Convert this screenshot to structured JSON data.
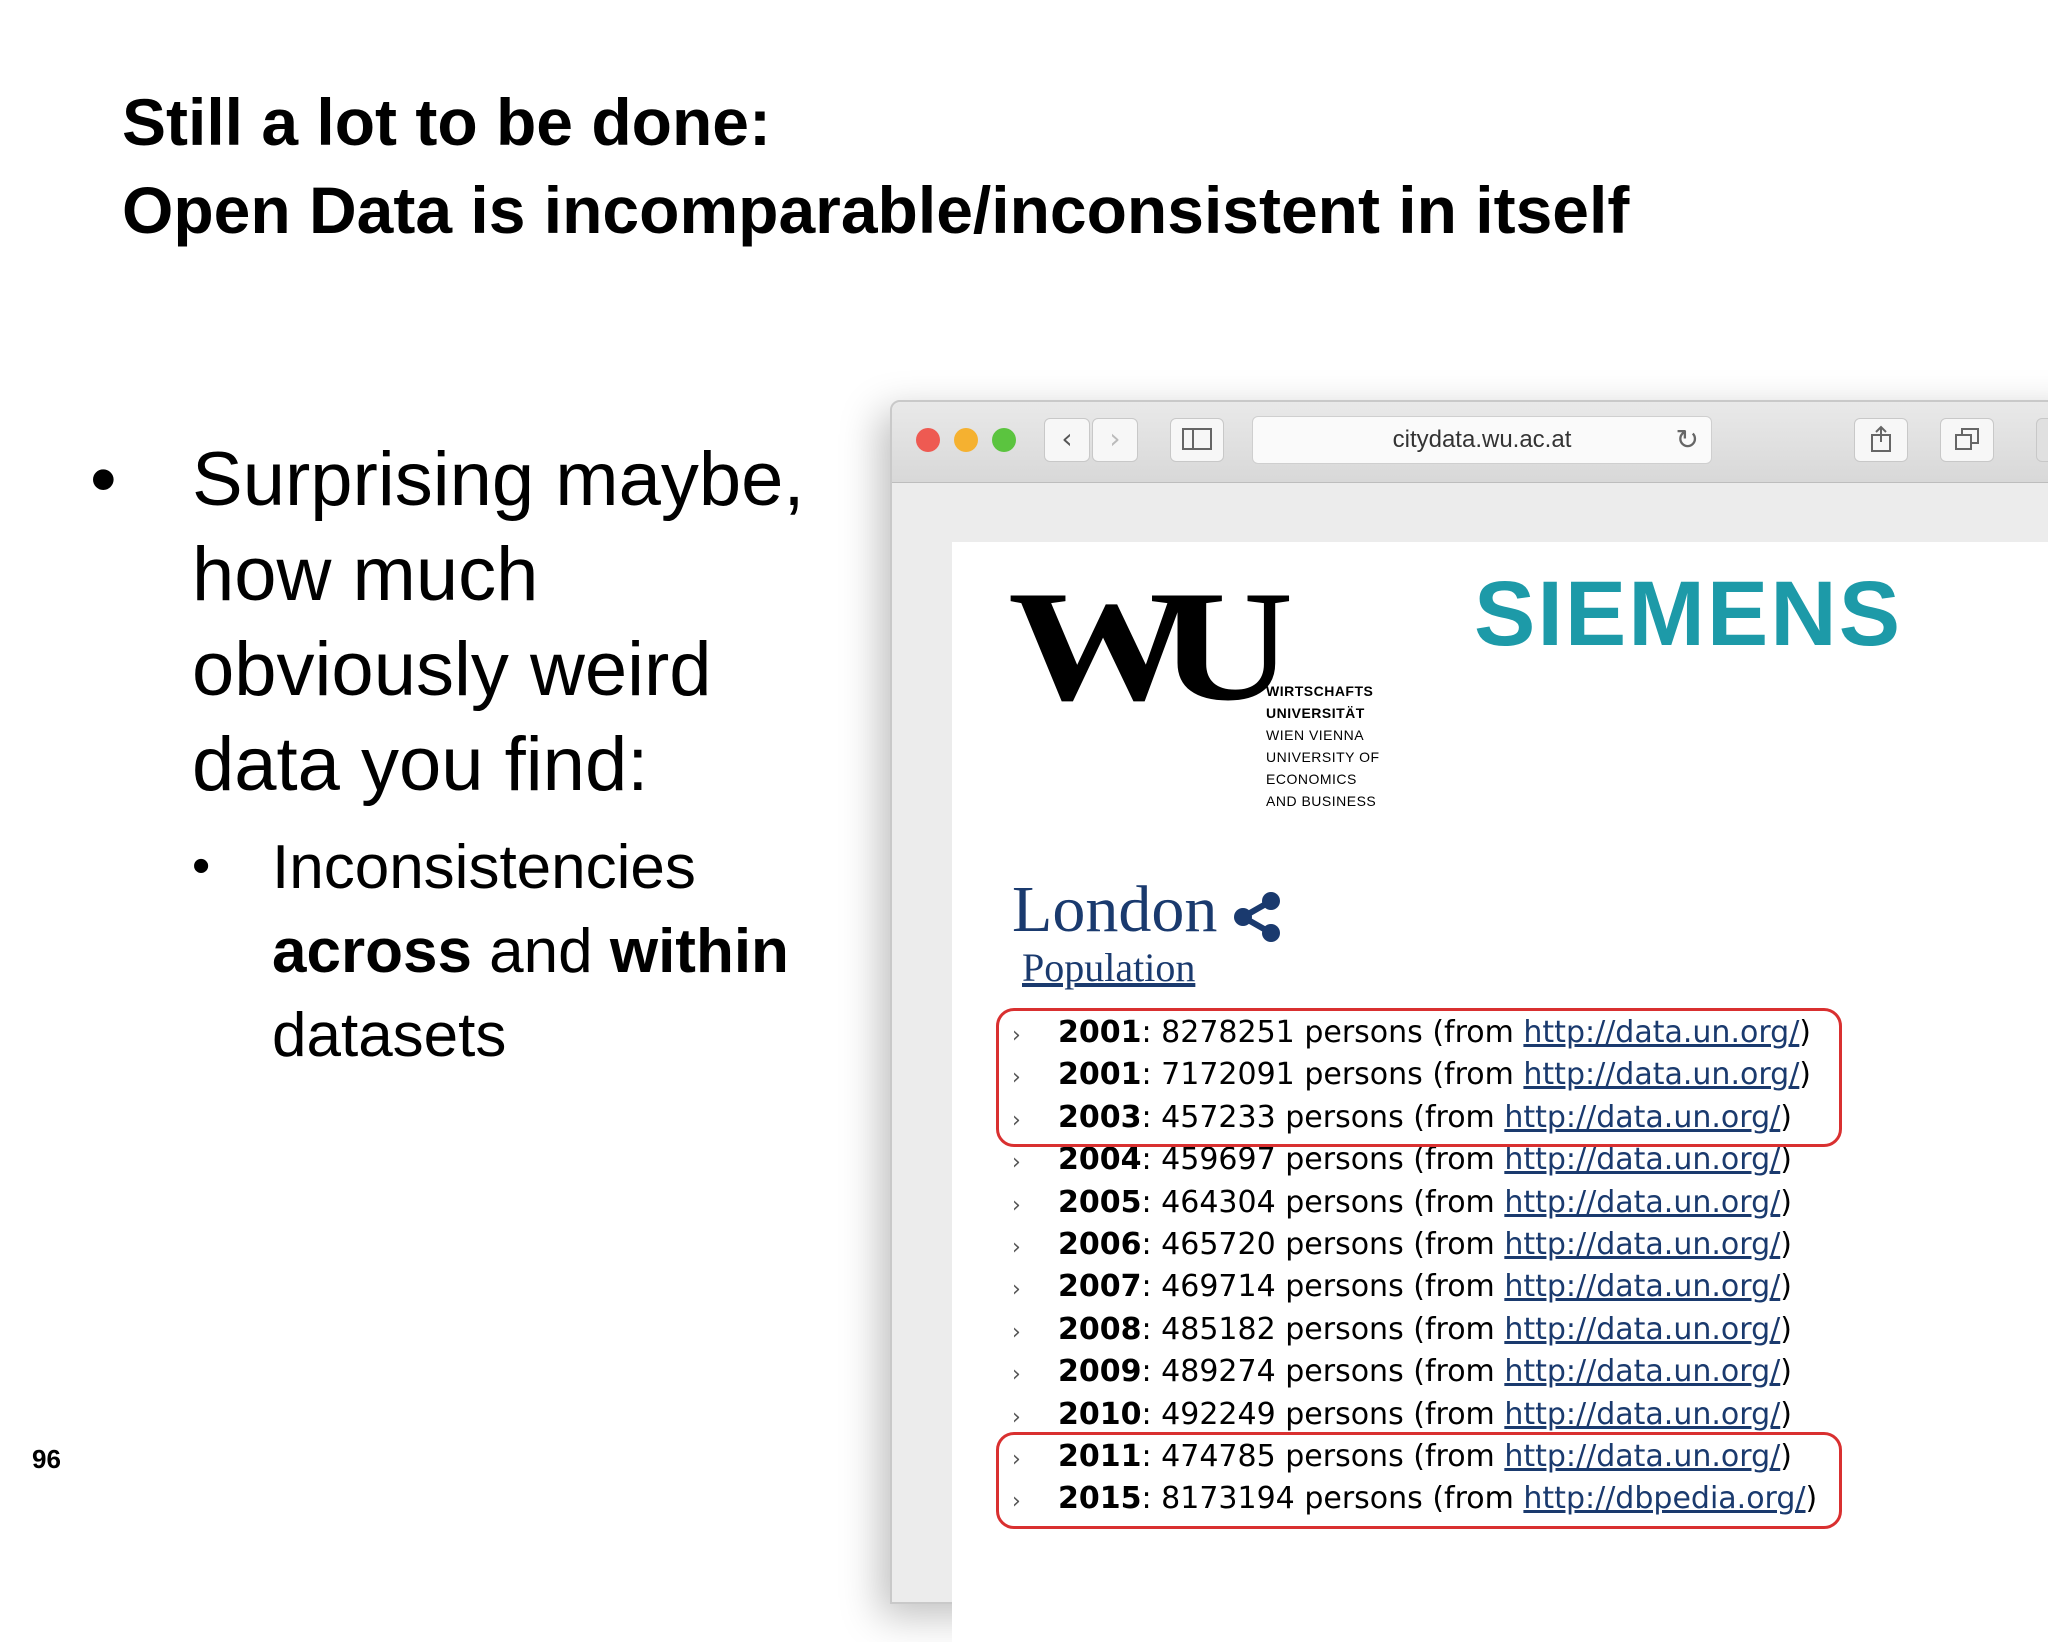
{
  "slide": {
    "title_line1": "Still a lot to be done:",
    "title_line2": "Open Data is incomparable/inconsistent in itself",
    "bullet1": "Surprising maybe, how much obviously weird data you find:",
    "sub_bullet": {
      "text1": "Inconsistencies",
      "bold1": "across",
      "text2": "and",
      "bold2": "within",
      "text3": "datasets"
    },
    "page_number": "96",
    "bullet_glyph": "•"
  },
  "browser": {
    "url": "citydata.wu.ac.at",
    "traffic_lights": {
      "close": "#ee5a52",
      "minimize": "#f5b130",
      "zoom": "#5bc43f"
    },
    "icons": {
      "back": "chevron-left-icon",
      "forward": "chevron-right-icon",
      "sidebar": "sidebar-icon",
      "reload": "reload-icon",
      "share": "share-icon",
      "tabs": "tabs-icon"
    }
  },
  "page": {
    "wu_logo_letters": "WU",
    "wu_logo_text": [
      "WIRTSCHAFTS",
      "UNIVERSITÄT",
      "WIEN VIENNA",
      "UNIVERSITY OF",
      "ECONOMICS",
      "AND BUSINESS"
    ],
    "siemens_logo": "SIEMENS",
    "siemens_color": "#1d9aa8",
    "city": "London",
    "section_link": "Population",
    "unit": "persons",
    "from_prefix": "(from",
    "from_suffix": ")",
    "rows": [
      {
        "year": "2001",
        "value": "8278251",
        "source": "http://data.un.org/"
      },
      {
        "year": "2001",
        "value": "7172091",
        "source": "http://data.un.org/"
      },
      {
        "year": "2003",
        "value": "457233",
        "source": "http://data.un.org/"
      },
      {
        "year": "2004",
        "value": "459697",
        "source": "http://data.un.org/"
      },
      {
        "year": "2005",
        "value": "464304",
        "source": "http://data.un.org/"
      },
      {
        "year": "2006",
        "value": "465720",
        "source": "http://data.un.org/"
      },
      {
        "year": "2007",
        "value": "469714",
        "source": "http://data.un.org/"
      },
      {
        "year": "2008",
        "value": "485182",
        "source": "http://data.un.org/"
      },
      {
        "year": "2009",
        "value": "489274",
        "source": "http://data.un.org/"
      },
      {
        "year": "2010",
        "value": "492249",
        "source": "http://data.un.org/"
      },
      {
        "year": "2011",
        "value": "474785",
        "source": "http://data.un.org/"
      },
      {
        "year": "2015",
        "value": "8173194",
        "source": "http://dbpedia.org/"
      }
    ],
    "highlight_color": "#d93030"
  }
}
